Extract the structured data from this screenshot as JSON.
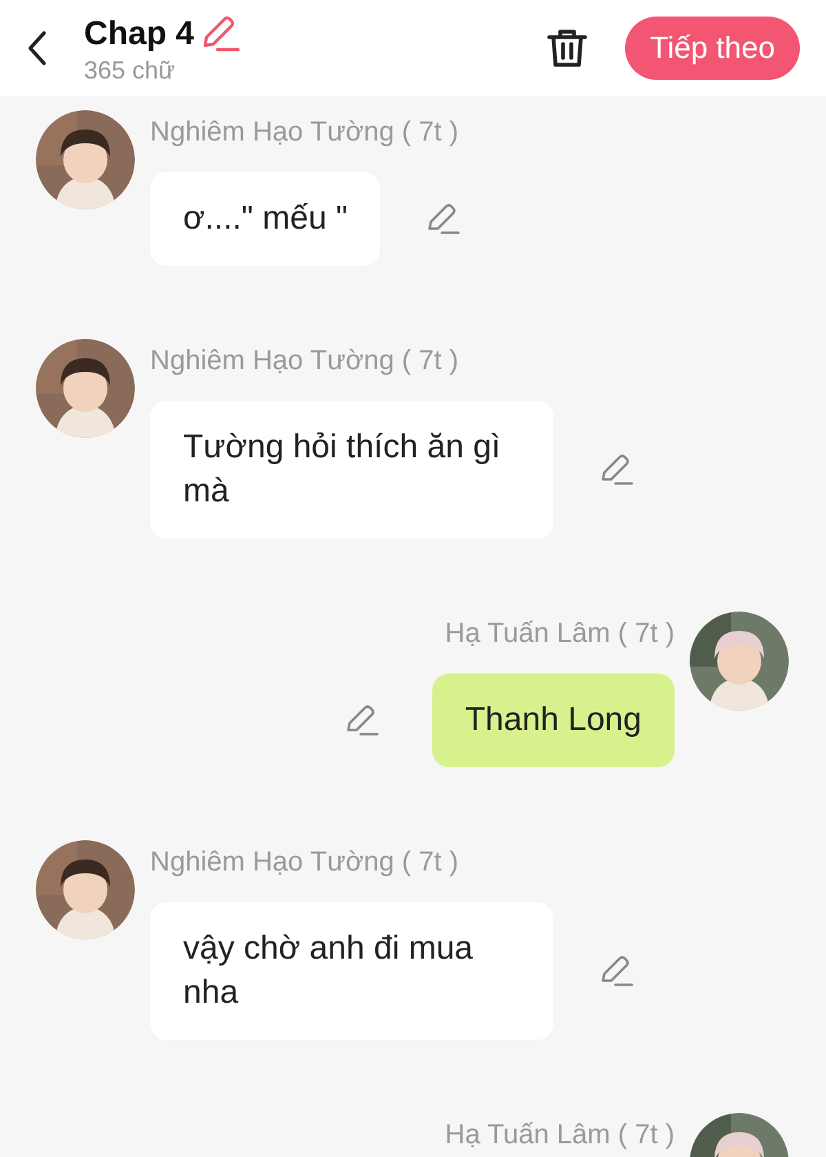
{
  "header": {
    "title": "Chap 4",
    "word_count": "365 chữ",
    "next_button": "Tiếp theo"
  },
  "messages": [
    {
      "kind": "incoming",
      "sender": "Nghiêm Hạo Tường ( 7t )",
      "text": "ơ....\" mếu \""
    },
    {
      "kind": "incoming",
      "sender": "Nghiêm Hạo Tường ( 7t )",
      "text": "Tường hỏi thích ăn gì mà"
    },
    {
      "kind": "outgoing",
      "sender": "Hạ Tuấn Lâm ( 7t )",
      "text": "Thanh Long"
    },
    {
      "kind": "incoming",
      "sender": "Nghiêm Hạo Tường ( 7t )",
      "text": "vậy chờ anh đi mua nha"
    },
    {
      "kind": "outgoing",
      "sender": "Hạ Tuấn Lâm ( 7t )"
    }
  ]
}
